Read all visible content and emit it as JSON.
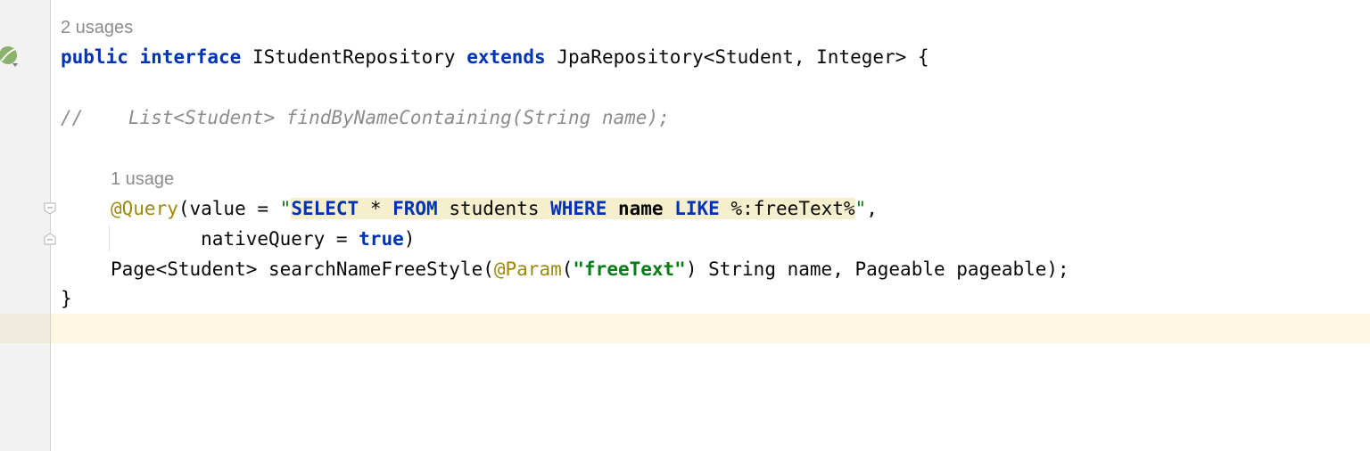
{
  "hints": {
    "interface_usages": "2 usages",
    "method_usages": "1 usage"
  },
  "code": {
    "l1": {
      "public": "public",
      "interface": "interface",
      "name": "IStudentRepository",
      "extends": "extends",
      "type": "JpaRepository<Student, Integer> {"
    },
    "l2": {
      "comment": "//    List<Student> findByNameContaining(String name);"
    },
    "l3": {
      "annotation": "@Query",
      "pre": "(value = ",
      "q_open": "\"",
      "select": "SELECT",
      "star": " * ",
      "from": "FROM",
      "students": " students ",
      "where": "WHERE",
      "sp1": " ",
      "name": "name",
      "sp2": " ",
      "like": "LIKE",
      "rest": " %:freeText%",
      "q_close": "\"",
      "comma": ","
    },
    "l4": {
      "native": "        nativeQuery = ",
      "true": "true",
      "paren": ")"
    },
    "l5": {
      "pre": "Page<Student> searchNameFreeStyle(",
      "param": "@Param",
      "open": "(",
      "str": "\"freeText\"",
      "post": ") String name, Pageable pageable);"
    },
    "l6": {
      "brace": "}"
    }
  },
  "icons": {
    "gutter_marker": "spring-bean-icon",
    "fold_start": "fold-open-icon",
    "fold_end": "fold-close-icon"
  }
}
